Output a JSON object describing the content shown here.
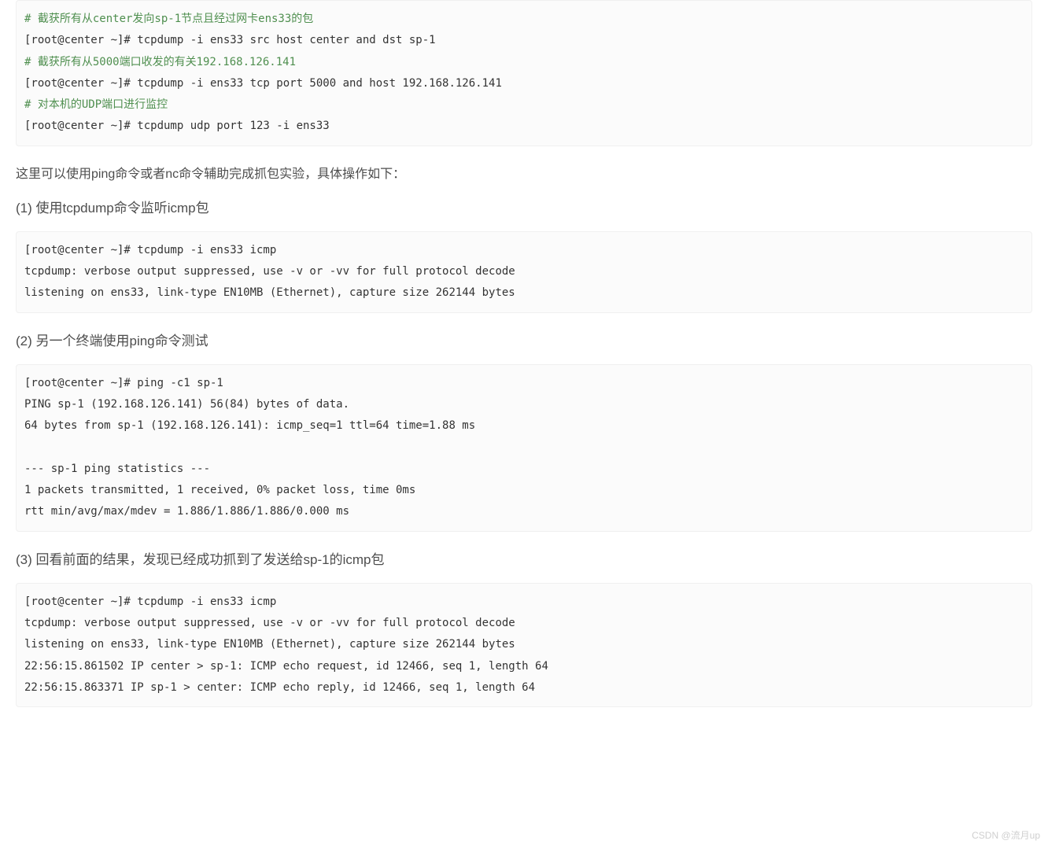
{
  "block1": {
    "l1_comment": "# 截获所有从center发向sp-1节点且经过网卡ens33的包",
    "l2": "[root@center ~]# tcpdump -i ens33 src host center and dst sp-1",
    "l3_comment": "# 截获所有从5000端口收发的有关192.168.126.141",
    "l4": "[root@center ~]# tcpdump -i ens33 tcp port 5000 and host 192.168.126.141",
    "l5_comment": "# 对本机的UDP端口进行监控",
    "l6": "[root@center ~]# tcpdump udp port 123 -i ens33"
  },
  "para1": "这里可以使用ping命令或者nc命令辅助完成抓包实验，具体操作如下：",
  "step1_heading": "(1) 使用tcpdump命令监听icmp包",
  "block2": "[root@center ~]# tcpdump -i ens33 icmp\ntcpdump: verbose output suppressed, use -v or -vv for full protocol decode\nlistening on ens33, link-type EN10MB (Ethernet), capture size 262144 bytes\n",
  "step2_heading": "(2) 另一个终端使用ping命令测试",
  "block3": "[root@center ~]# ping -c1 sp-1\nPING sp-1 (192.168.126.141) 56(84) bytes of data.\n64 bytes from sp-1 (192.168.126.141): icmp_seq=1 ttl=64 time=1.88 ms\n\n--- sp-1 ping statistics ---\n1 packets transmitted, 1 received, 0% packet loss, time 0ms\nrtt min/avg/max/mdev = 1.886/1.886/1.886/0.000 ms",
  "step3_heading": "(3) 回看前面的结果，发现已经成功抓到了发送给sp-1的icmp包",
  "block4": "[root@center ~]# tcpdump -i ens33 icmp\ntcpdump: verbose output suppressed, use -v or -vv for full protocol decode\nlistening on ens33, link-type EN10MB (Ethernet), capture size 262144 bytes\n22:56:15.861502 IP center > sp-1: ICMP echo request, id 12466, seq 1, length 64\n22:56:15.863371 IP sp-1 > center: ICMP echo reply, id 12466, seq 1, length 64",
  "watermark": "CSDN @流月up"
}
